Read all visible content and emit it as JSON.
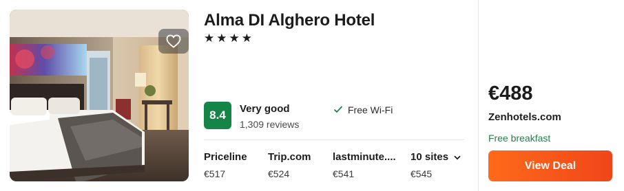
{
  "hotel": {
    "name": "Alma DI Alghero Hotel",
    "stars": "★★★★",
    "rating_score": "8.4",
    "rating_label": "Very good",
    "reviews": "1,309 reviews",
    "amenity": "Free Wi-Fi"
  },
  "sites": [
    {
      "name": "Priceline",
      "price": "€517"
    },
    {
      "name": "Trip.com",
      "price": "€524"
    },
    {
      "name": "lastminute....",
      "price": "€541"
    },
    {
      "name": "10 sites",
      "price": "€545"
    }
  ],
  "deal": {
    "price": "€488",
    "provider": "Zenhotels.com",
    "perk": "Free breakfast",
    "button_label": "View Deal"
  },
  "colors": {
    "score_badge": "#158447",
    "perk_text": "#1d8348",
    "deal_button": "#f5521a"
  },
  "icons": {
    "favorite": "heart-outline-icon",
    "amenity": "check-icon",
    "more_sites": "chevron-down-icon"
  }
}
